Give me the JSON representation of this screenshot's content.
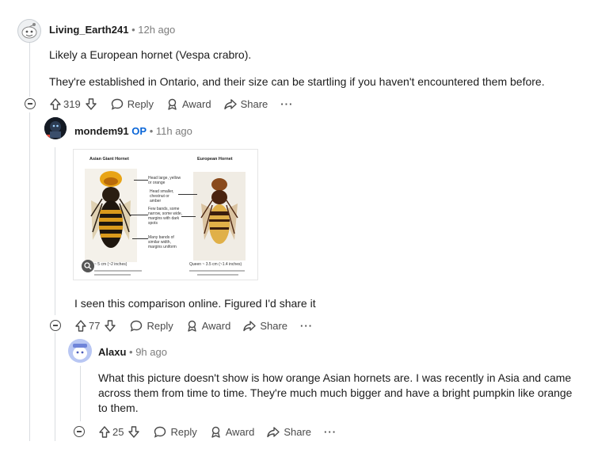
{
  "comments": [
    {
      "username": "Living_Earth241",
      "time": "12h ago",
      "paragraphs": [
        "Likely a European hornet (Vespa crabro).",
        "They're established in Ontario, and their size can be startling if you haven't encountered them before."
      ],
      "votes": "319",
      "reply_label": "Reply",
      "award_label": "Award",
      "share_label": "Share",
      "more_label": "···"
    },
    {
      "username": "mondem91",
      "op_badge": "OP",
      "time": "11h ago",
      "image": {
        "left_title": "Asian Giant Hornet",
        "right_title": "European Hornet",
        "note1": "Head large, yellow or orange",
        "note2": "Head smaller, chestnut or amber",
        "note3": "Few bands, some narrow, some wide, margins with dark spots",
        "note4": "Many bands of similar width, margins uniform",
        "left_caption": "~ 5 cm (~2 inches)",
        "right_caption": "Queen ~ 3.5 cm (~1.4 inches)"
      },
      "paragraphs": [
        "I seen this comparison online. Figured I'd share it"
      ],
      "votes": "77",
      "reply_label": "Reply",
      "award_label": "Award",
      "share_label": "Share",
      "more_label": "···"
    },
    {
      "username": "Alaxu",
      "time": "9h ago",
      "paragraphs": [
        "What this picture doesn't show is how orange Asian hornets are. I was recently in Asia and came across them from time to time. They're much much bigger and have a bright pumpkin like orange to them."
      ],
      "votes": "25",
      "reply_label": "Reply",
      "award_label": "Award",
      "share_label": "Share",
      "more_label": "···"
    }
  ],
  "colors": {
    "text": "#1c1c1c",
    "muted": "#7c7c7c",
    "op_blue": "#0a66d8",
    "thread_line": "#dadde1"
  }
}
